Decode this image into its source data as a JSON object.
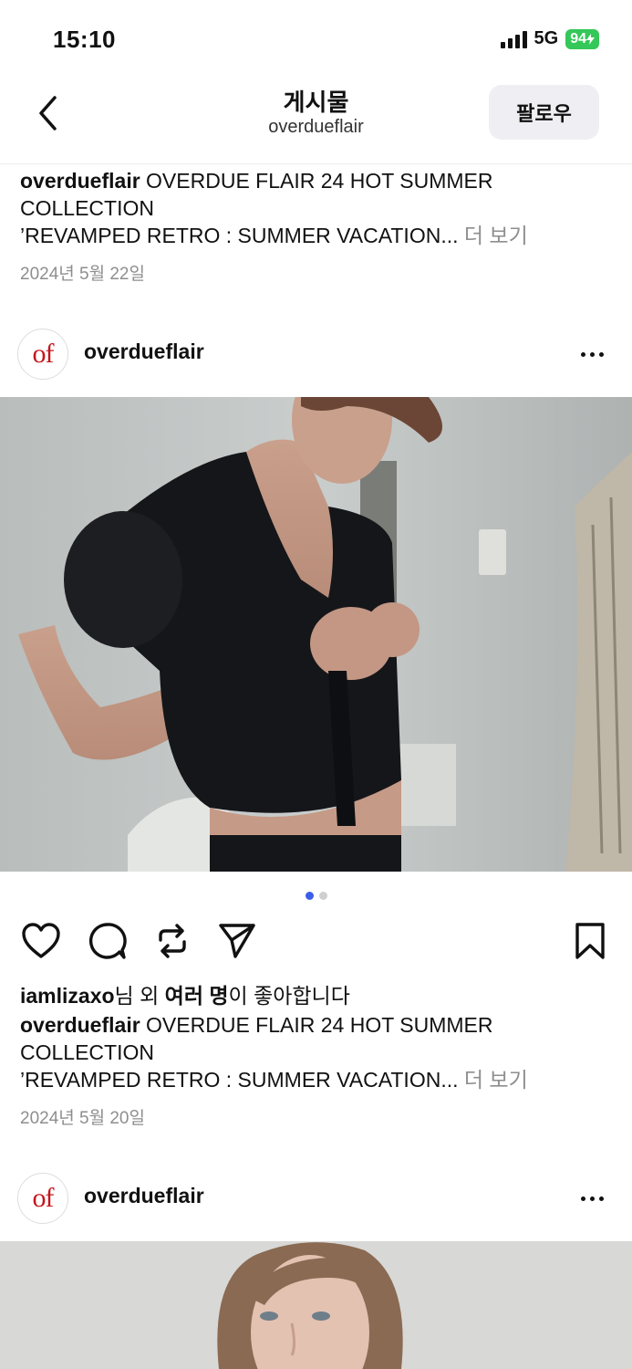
{
  "status_bar": {
    "time": "15:10",
    "network": "5G",
    "battery": "94"
  },
  "header": {
    "title": "게시물",
    "subtitle": "overdueflair",
    "follow_label": "팔로우"
  },
  "post1": {
    "caption_user": "overdueflair",
    "caption_text": " OVERDUE FLAIR 24 HOT SUMMER COLLECTION",
    "caption_line2": "’REVAMPED RETRO : SUMMER VACATION...",
    "more_label": " 더 보기",
    "date": "2024년 5월 22일"
  },
  "post2": {
    "avatar_text": "of",
    "username": "overdueflair",
    "likes_user": "iamlizaxo",
    "likes_text_mid": "님 외 ",
    "likes_text_bold": "여러 명",
    "likes_text_end": "이 좋아합니다",
    "caption_user": "overdueflair",
    "caption_text": " OVERDUE FLAIR 24 HOT SUMMER COLLECTION",
    "caption_line2": "’REVAMPED RETRO : SUMMER VACATION...",
    "more_label": " 더 보기",
    "date": "2024년 5월 20일",
    "carousel": {
      "count": 2,
      "active": 1
    }
  },
  "post3": {
    "avatar_text": "of",
    "username": "overdueflair"
  },
  "icons": {
    "back": "chevron-left-icon",
    "more": "more-horizontal-icon",
    "like": "heart-icon",
    "comment": "comment-icon",
    "repost": "repost-icon",
    "share": "send-icon",
    "save": "bookmark-icon"
  },
  "colors": {
    "accent_dot": "#3c5ee6",
    "brand_red": "#c4161c",
    "battery_green": "#34c759",
    "muted_text": "#8e8e8e"
  }
}
